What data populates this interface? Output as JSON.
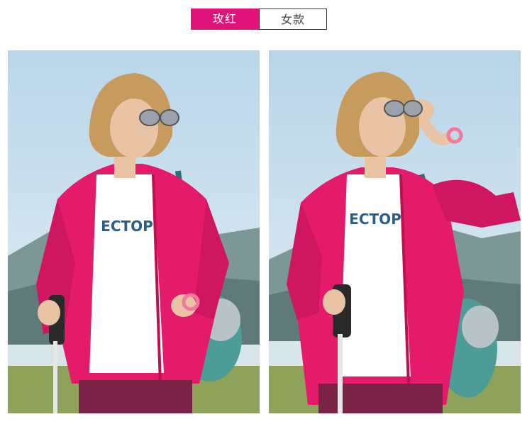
{
  "tags": {
    "color": "玫红",
    "style": "女款"
  },
  "shirt_text": "ECTOP",
  "photos": [
    {
      "alt": "hiker-woman-front"
    },
    {
      "alt": "hiker-woman-sunglasses-pose"
    }
  ],
  "colors": {
    "accent": "#e0137a",
    "jacket": "#e31b6a",
    "jacket_shadow": "#b8124f",
    "sky": "#cfe3ee",
    "mountains": "#6f8b8c",
    "water": "#d9e6ea",
    "grass": "#8ea25a",
    "pants": "#7a2346",
    "hair": "#c79a5e",
    "skin": "#e8c3a5"
  }
}
